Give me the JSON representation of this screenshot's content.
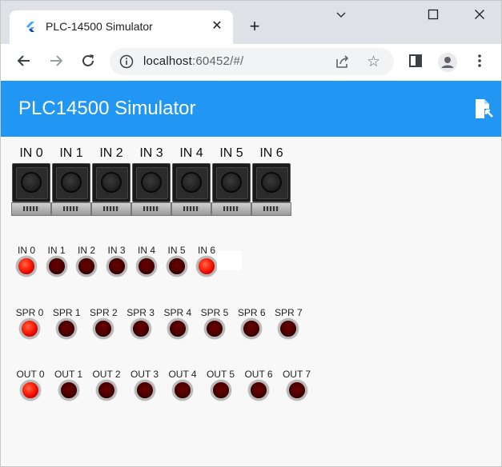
{
  "browser": {
    "tab_title": "PLC-14500 Simulator",
    "tab_close": "✕",
    "new_tab": "+",
    "url_host": "localhost",
    "url_rest": ":60452/#/",
    "window_minimize": "⌄",
    "window_restore": "☐",
    "window_close": "✕"
  },
  "app": {
    "title": "PLC14500 Simulator"
  },
  "push_buttons": [
    "IN 0",
    "IN 1",
    "IN 2",
    "IN 3",
    "IN 4",
    "IN 5",
    "IN 6"
  ],
  "inputs": {
    "labels": [
      "IN 0",
      "IN 1",
      "IN 2",
      "IN 3",
      "IN 4",
      "IN 5",
      "IN 6"
    ],
    "states": [
      true,
      false,
      false,
      false,
      false,
      false,
      true
    ]
  },
  "scratchpad": {
    "labels": [
      "SPR 0",
      "SPR 1",
      "SPR 2",
      "SPR 3",
      "SPR 4",
      "SPR 5",
      "SPR 6",
      "SPR 7"
    ],
    "states": [
      true,
      false,
      false,
      false,
      false,
      false,
      false,
      false
    ]
  },
  "outputs": {
    "labels": [
      "OUT 0",
      "OUT 1",
      "OUT 2",
      "OUT 3",
      "OUT 4",
      "OUT 5",
      "OUT 6",
      "OUT 7"
    ],
    "states": [
      true,
      false,
      false,
      false,
      false,
      false,
      false,
      false
    ]
  },
  "colors": {
    "app_bar": "#2196f3",
    "led_on": "#ff2a10",
    "led_off": "#4a0000"
  }
}
